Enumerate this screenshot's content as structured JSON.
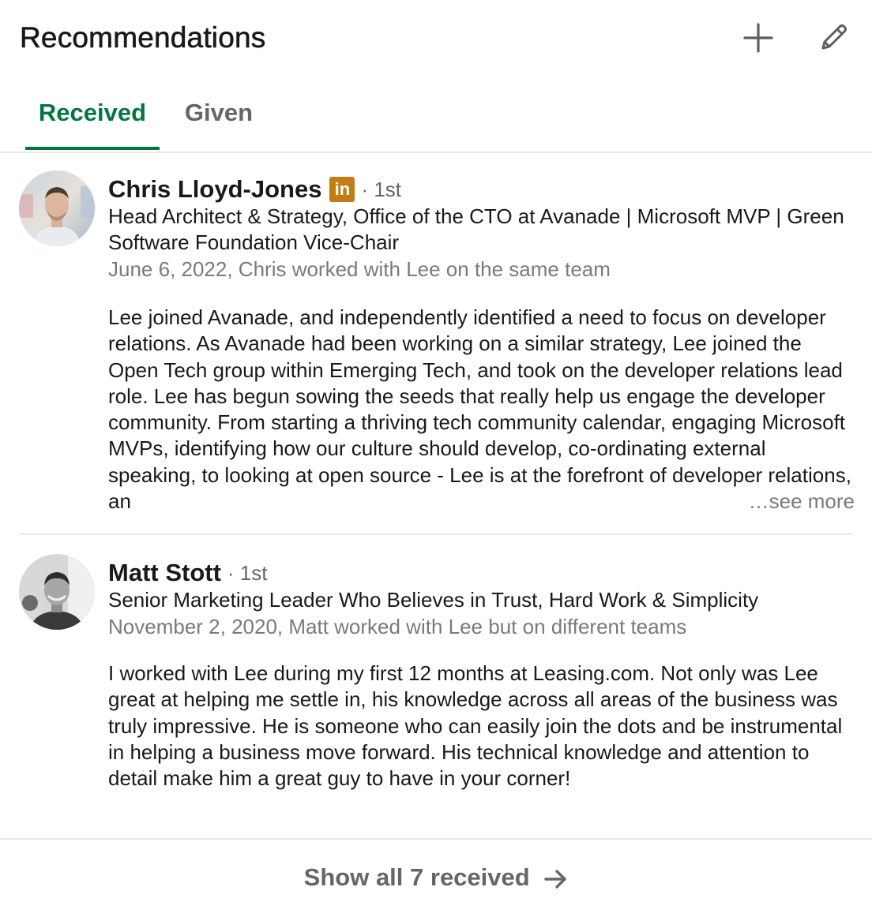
{
  "header": {
    "title": "Recommendations",
    "add_icon": "plus-icon",
    "edit_icon": "pencil-icon"
  },
  "tabs": [
    {
      "label": "Received",
      "active": true
    },
    {
      "label": "Given",
      "active": false
    }
  ],
  "recommendations": [
    {
      "name": "Chris Lloyd-Jones",
      "badge": "in",
      "degree": "· 1st",
      "headline": "Head Architect & Strategy, Office of the CTO at Avanade | Microsoft MVP | Green Software Foundation Vice-Chair",
      "meta": "June 6, 2022, Chris worked with Lee on the same team",
      "text": "Lee joined Avanade, and independently identified a need to focus on developer relations. As Avanade had been working on a similar strategy, Lee joined the Open Tech group within Emerging Tech, and took on the developer relations lead role. Lee has begun sowing the seeds that really help us engage the developer community. From starting a thriving tech community calendar, engaging Microsoft MVPs, identifying how our culture should develop, co-ordinating external speaking, to looking at open source - Lee is at the forefront of developer relations, an",
      "see_more": "…see more"
    },
    {
      "name": "Matt Stott",
      "degree": "· 1st",
      "headline": "Senior Marketing Leader Who Believes in Trust, Hard Work & Simplicity",
      "meta": "November 2, 2020, Matt worked with Lee but on different teams",
      "text": "I worked with Lee during my first 12 months at Leasing.com. Not only was Lee great at helping me settle in, his knowledge across all areas of the business was truly impressive. He is someone who can easily join the dots and be instrumental in helping a business move forward. His technical knowledge and attention to detail make him a great guy to have in your corner!"
    }
  ],
  "footer": {
    "show_all": "Show all 7 received",
    "arrow_icon": "arrow-right-icon"
  },
  "colors": {
    "accent_green": "#057642",
    "muted_gray": "#666666",
    "linkedin_badge": "#c37d16"
  }
}
